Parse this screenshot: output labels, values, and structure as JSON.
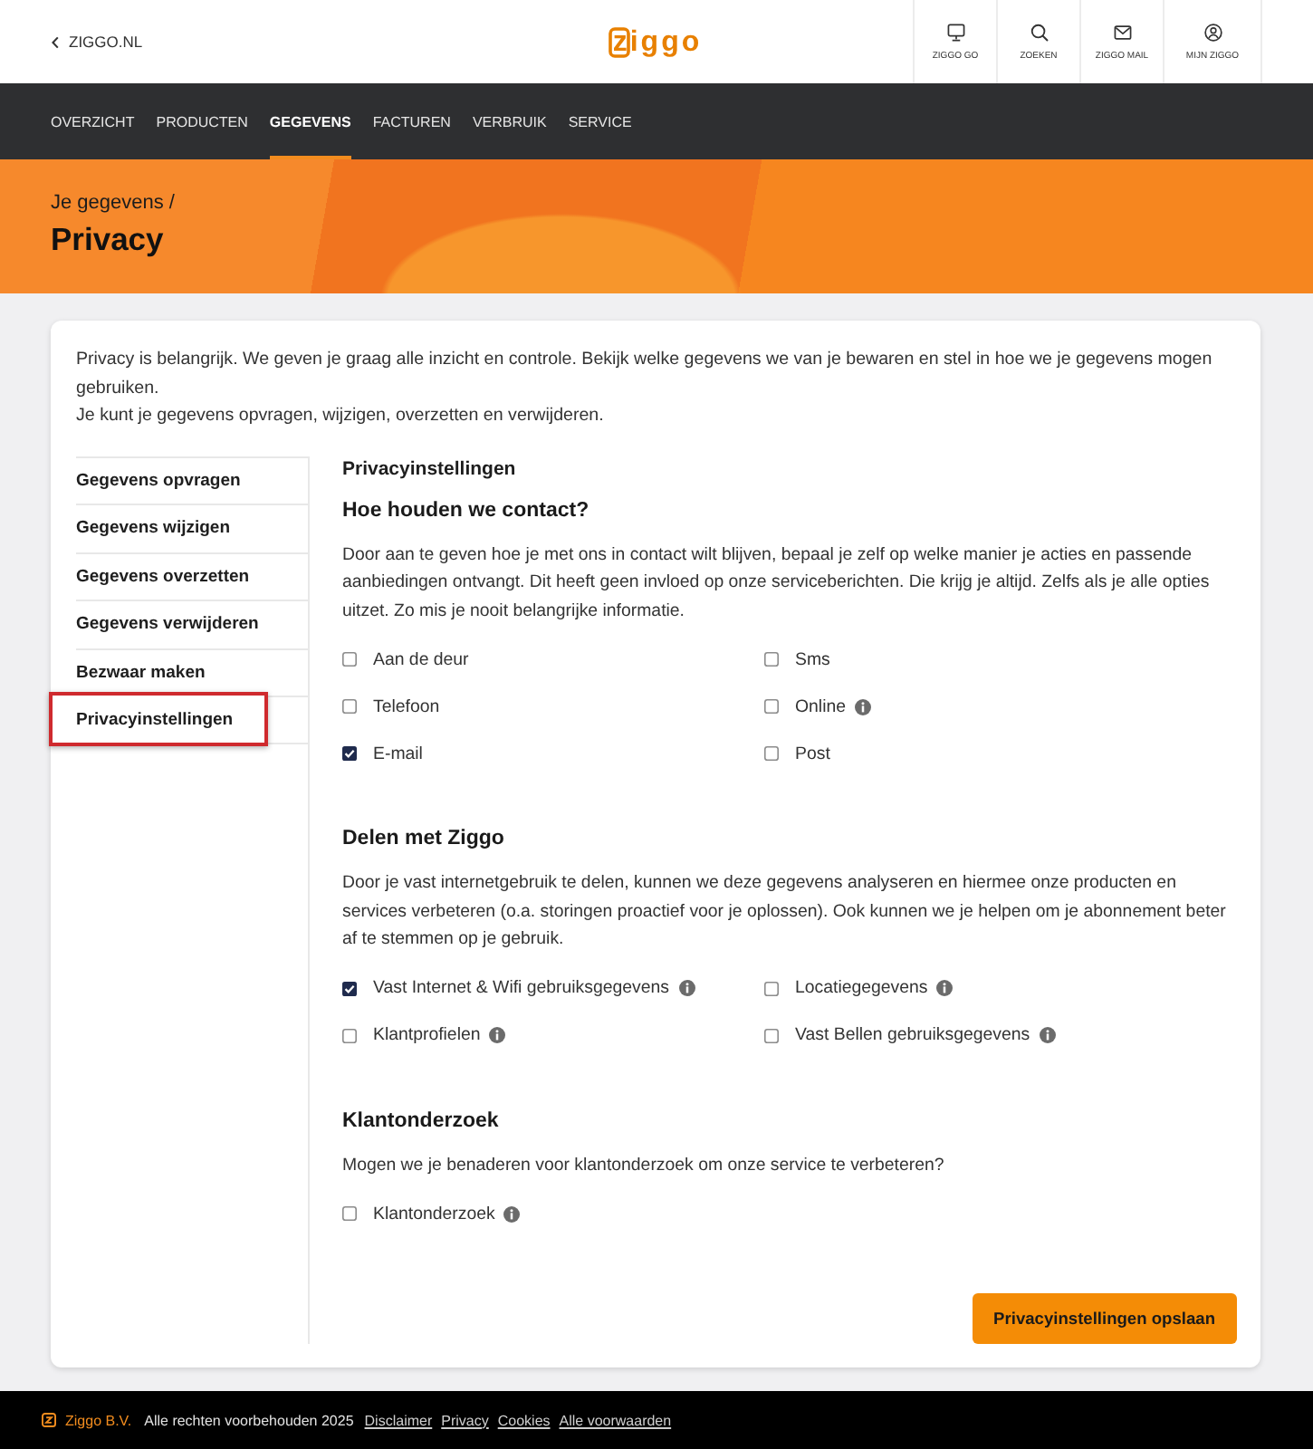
{
  "header": {
    "back_link": "ZIGGO.NL",
    "logo": "ziggo",
    "actions": [
      {
        "label": "ZIGGO GO"
      },
      {
        "label": "ZOEKEN"
      },
      {
        "label": "ZIGGO MAIL"
      },
      {
        "label": "MIJN ZIGGO"
      }
    ]
  },
  "nav": [
    {
      "label": "OVERZICHT",
      "selected": false
    },
    {
      "label": "PRODUCTEN",
      "selected": false
    },
    {
      "label": "GEGEVENS",
      "selected": true
    },
    {
      "label": "FACTUREN",
      "selected": false
    },
    {
      "label": "VERBRUIK",
      "selected": false
    },
    {
      "label": "SERVICE",
      "selected": false
    }
  ],
  "banner": {
    "breadcrumb": "Je gegevens /",
    "title": "Privacy"
  },
  "intro": [
    "Privacy is belangrijk. We geven je graag alle inzicht en controle. Bekijk welke gegevens we van je bewaren en stel in hoe we je gegevens mogen gebruiken.",
    "Je kunt je gegevens opvragen, wijzigen, overzetten en verwijderen."
  ],
  "sidebar": {
    "items": [
      {
        "label": "Gegevens opvragen",
        "selected": false
      },
      {
        "label": "Gegevens wijzigen",
        "selected": false
      },
      {
        "label": "Gegevens overzetten",
        "selected": false
      },
      {
        "label": "Gegevens verwijderen",
        "selected": false
      },
      {
        "label": "Bezwaar maken",
        "selected": false
      },
      {
        "label": "Privacyinstellingen",
        "selected": true
      }
    ]
  },
  "settings": {
    "title": "Privacyinstellingen",
    "sections": [
      {
        "heading": "Hoe houden we contact?",
        "text": "Door aan te geven hoe je met ons in contact wilt blijven, bepaal je zelf op welke manier je acties en passende aanbiedingen ontvangt. Dit heeft geen invloed op onze serviceberichten. Die krijg je altijd. Zelfs als je alle opties uitzet. Zo mis je nooit belangrijke informatie.",
        "options": [
          {
            "label": "Aan de deur",
            "checked": false,
            "info": false
          },
          {
            "label": "Sms",
            "checked": false,
            "info": false
          },
          {
            "label": "Telefoon",
            "checked": false,
            "info": false
          },
          {
            "label": "Online",
            "checked": false,
            "info": true
          },
          {
            "label": "E-mail",
            "checked": true,
            "info": false
          },
          {
            "label": "Post",
            "checked": false,
            "info": false
          }
        ]
      },
      {
        "heading": "Delen met Ziggo",
        "text": "Door je vast internetgebruik te delen, kunnen we deze gegevens analyseren en hiermee onze producten en services verbeteren (o.a. storingen proactief voor je oplossen). Ook kunnen we je helpen om je abonnement beter af te stemmen op je gebruik.",
        "options": [
          {
            "label": "Vast Internet & Wifi gebruiksgegevens",
            "checked": true,
            "info": true
          },
          {
            "label": "Locatiegegevens",
            "checked": false,
            "info": true
          },
          {
            "label": "Klantprofielen",
            "checked": false,
            "info": true
          },
          {
            "label": "Vast Bellen gebruiksgegevens",
            "checked": false,
            "info": true
          }
        ]
      },
      {
        "heading": "Klantonderzoek",
        "text": "Mogen we je benaderen voor klantonderzoek om onze service te verbeteren?",
        "options": [
          {
            "label": "Klantonderzoek",
            "checked": false,
            "info": true
          }
        ]
      }
    ],
    "save_button": "Privacyinstellingen opslaan"
  },
  "footer": {
    "company": "Ziggo B.V.",
    "copyright": "Alle rechten voorbehouden 2025",
    "links": [
      "Disclaimer",
      "Privacy",
      "Cookies",
      "Alle voorwaarden"
    ]
  }
}
